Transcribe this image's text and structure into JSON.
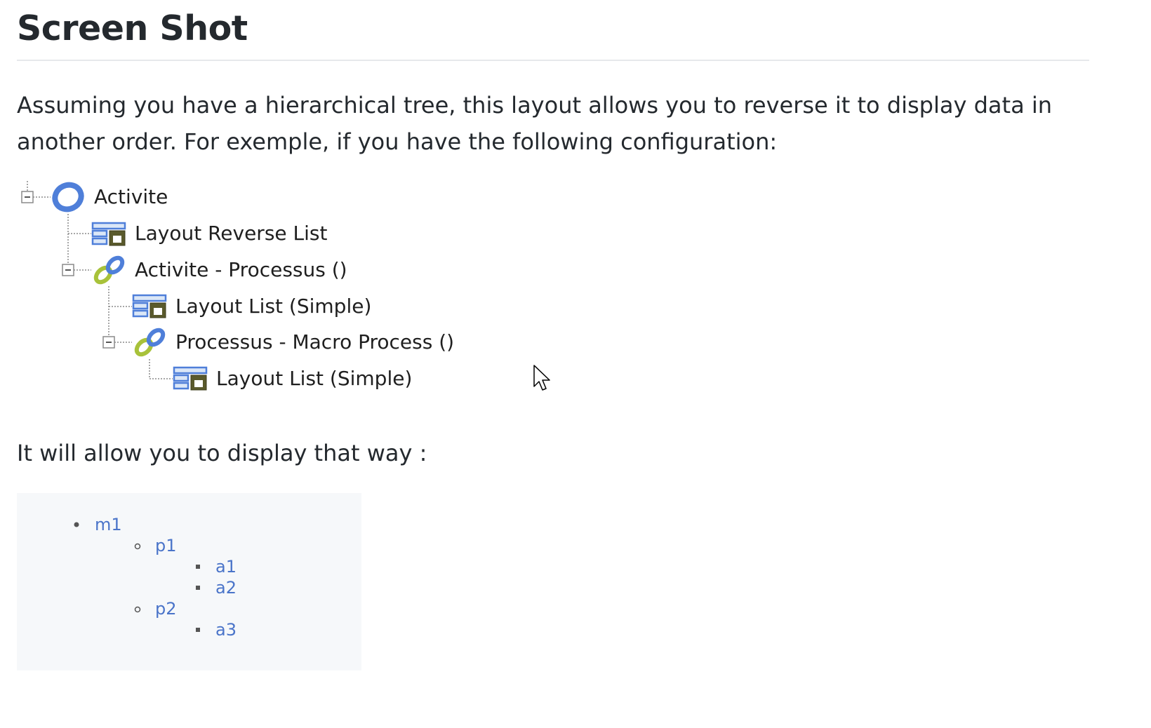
{
  "heading": "Screen Shot",
  "intro": "Assuming you have a hierarchical tree, this layout allows you to reverse it to display data in another order. For exemple, if you have the following configuration:",
  "tree": [
    {
      "label": "Activite",
      "icon": "ring-icon"
    },
    {
      "label": "Layout Reverse List",
      "icon": "layout-icon"
    },
    {
      "label": "Activite - Processus ()",
      "icon": "link-icon"
    },
    {
      "label": "Layout List (Simple)",
      "icon": "layout-icon"
    },
    {
      "label": "Processus - Macro Process ()",
      "icon": "link-icon"
    },
    {
      "label": "Layout List (Simple)",
      "icon": "layout-icon"
    }
  ],
  "outro": "It will allow you to display that way :",
  "example": {
    "m1": "m1",
    "p1": "p1",
    "a1": "a1",
    "a2": "a2",
    "p2": "p2",
    "a3": "a3"
  },
  "colors": {
    "link": "#4a74c9",
    "ring": "#4f7fd9",
    "chain_green": "#a8c23a",
    "code_bg": "#f6f8fa"
  }
}
